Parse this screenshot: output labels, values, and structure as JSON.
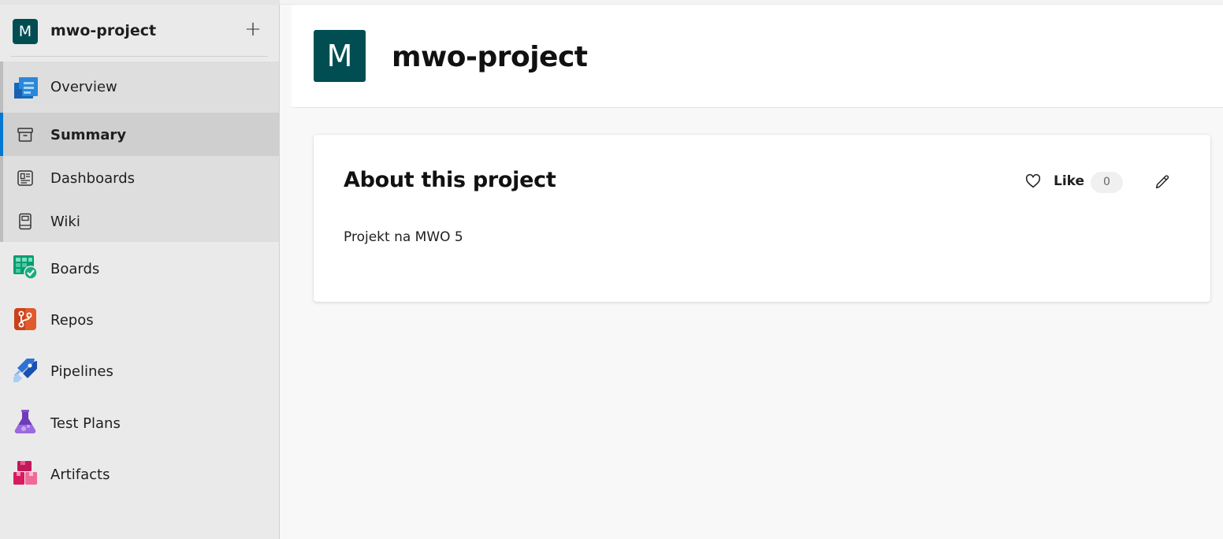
{
  "project": {
    "initial": "M",
    "name": "mwo-project",
    "add_glyph": "+"
  },
  "nav": {
    "overview": {
      "label": "Overview",
      "icon": "overview-icon"
    },
    "summary": {
      "label": "Summary",
      "icon": "summary-icon",
      "selected": true
    },
    "dashboards": {
      "label": "Dashboards",
      "icon": "dashboards-icon"
    },
    "wiki": {
      "label": "Wiki",
      "icon": "wiki-icon"
    },
    "boards": {
      "label": "Boards",
      "icon": "boards-icon"
    },
    "repos": {
      "label": "Repos",
      "icon": "repos-icon"
    },
    "pipelines": {
      "label": "Pipelines",
      "icon": "pipelines-icon"
    },
    "test_plans": {
      "label": "Test Plans",
      "icon": "test-plans-icon"
    },
    "artifacts": {
      "label": "Artifacts",
      "icon": "artifacts-icon"
    }
  },
  "header": {
    "initial": "M",
    "title": "mwo-project"
  },
  "about": {
    "title": "About this project",
    "description": "Projekt na MWO 5",
    "like_label": "Like",
    "like_count": "0"
  },
  "colors": {
    "avatar_bg": "#004e52",
    "selected_accent": "#0078d4",
    "sidebar_bg": "#eaeaea"
  }
}
